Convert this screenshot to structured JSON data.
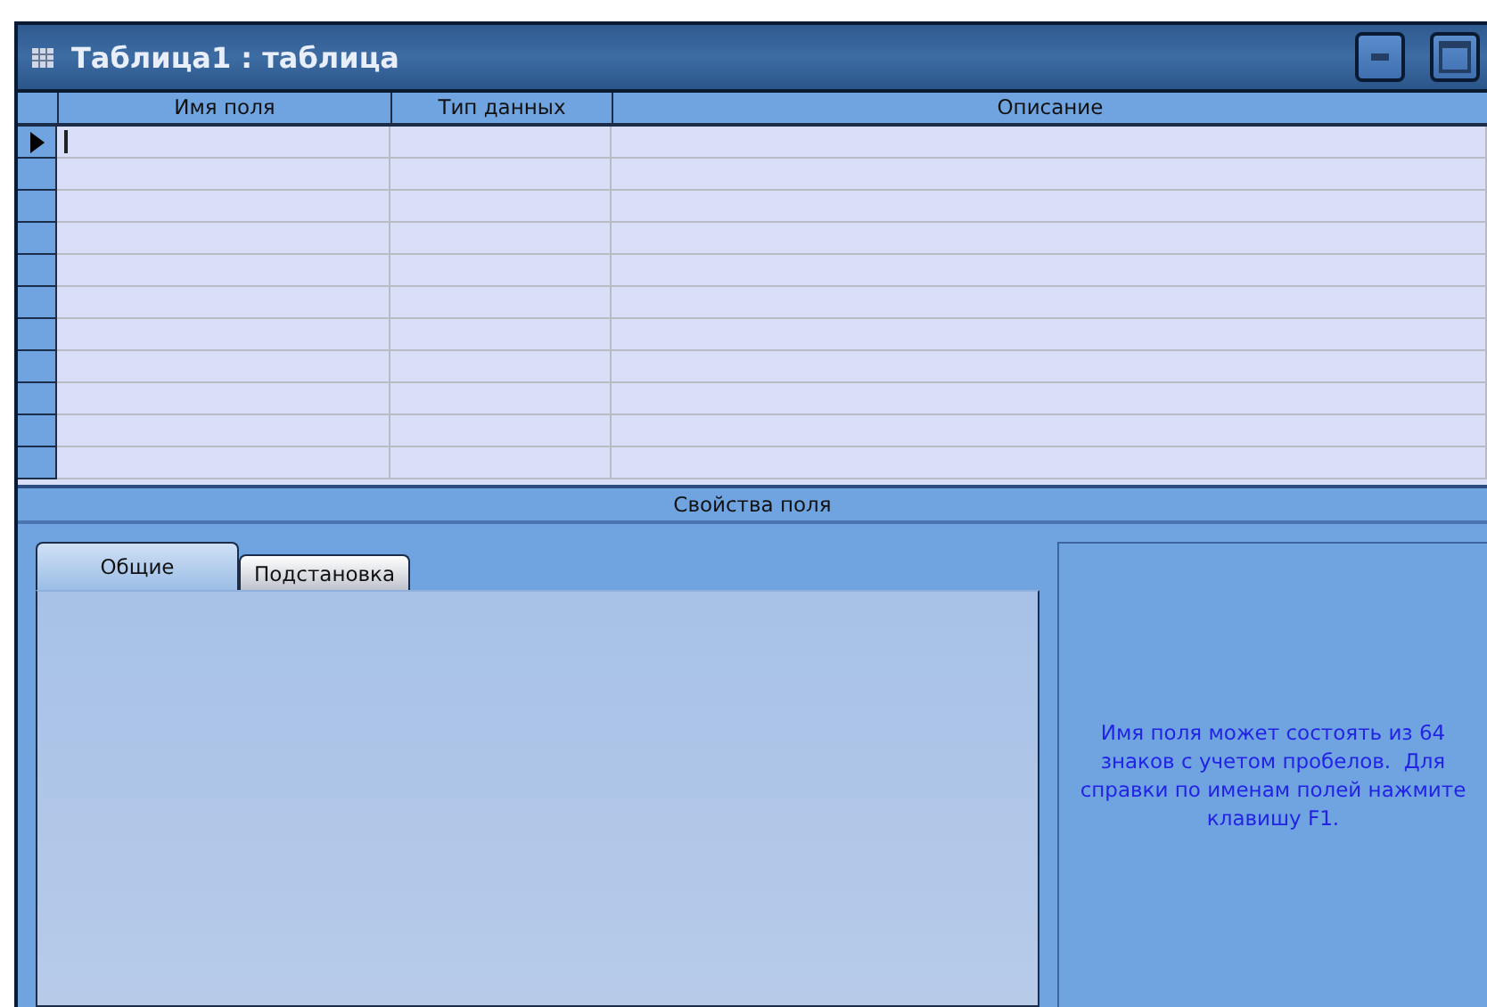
{
  "window": {
    "title": "Таблица1 : таблица"
  },
  "grid": {
    "columns": [
      "Имя поля",
      "Тип данных",
      "Описание"
    ],
    "rows": [
      {
        "current": true
      },
      {
        "current": false
      },
      {
        "current": false
      },
      {
        "current": false
      },
      {
        "current": false
      },
      {
        "current": false
      },
      {
        "current": false
      },
      {
        "current": false
      },
      {
        "current": false
      },
      {
        "current": false
      },
      {
        "current": false
      }
    ]
  },
  "properties": {
    "title": "Свойства поля",
    "tabs": [
      {
        "label": "Общие",
        "selected": true
      },
      {
        "label": "Подстановка",
        "selected": false
      }
    ],
    "help": "Имя поля может состоять из 64 знаков с учетом пробелов.  Для справки по именам полей нажмите клавишу F1."
  }
}
